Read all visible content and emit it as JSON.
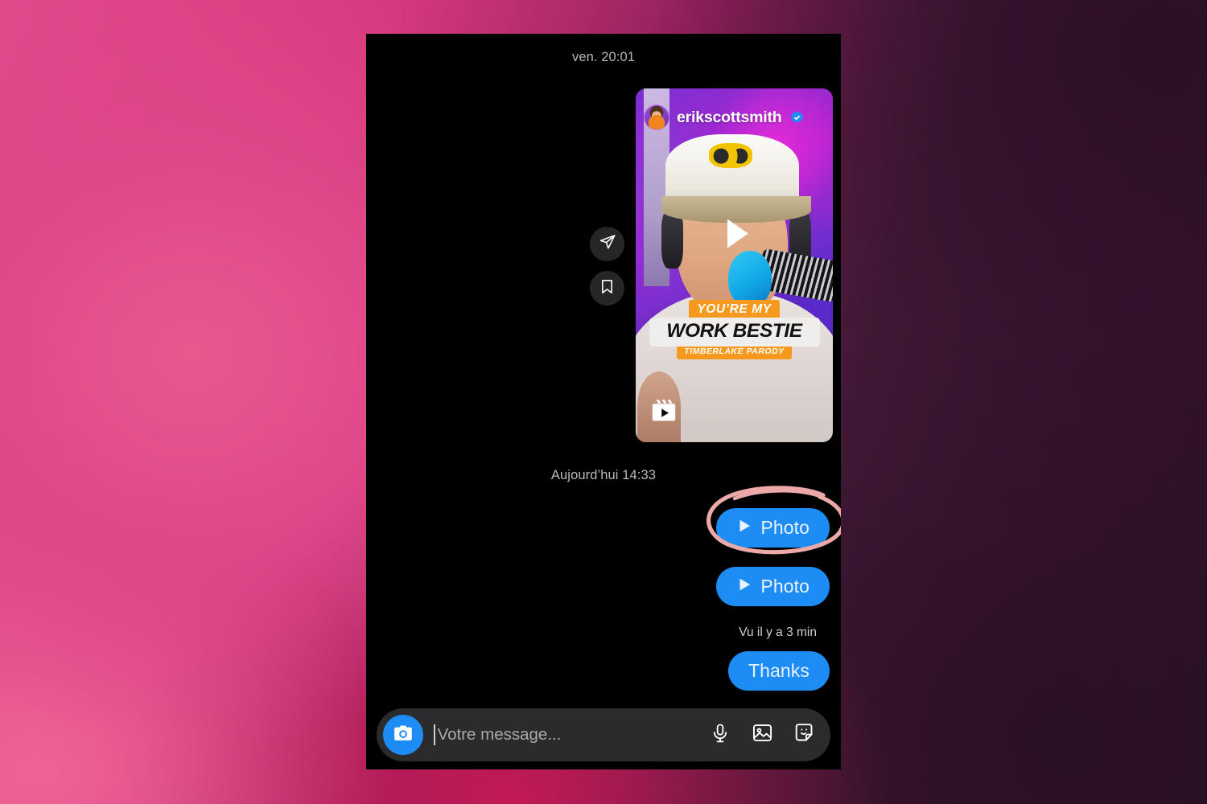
{
  "wallpaper": {
    "colors": {
      "pink": "#e0488a",
      "magenta": "#c21a56",
      "dark_purple": "#2b1128"
    }
  },
  "phone": {
    "screen_background": "#000000"
  },
  "thread": {
    "separator_top": "ven. 20:01",
    "separator_middle": "Aujourd’hui 14:33",
    "seen_status": "Vu il y a 3 min",
    "shared_reel": {
      "username": "erikscottsmith",
      "verified": true,
      "verified_badge_color": "#1d8cf5",
      "caption_line1": "YOU’RE MY",
      "caption_line2": "WORK BESTIE",
      "caption_line3": "TIMBERLAKE PARODY",
      "caption_accent_color": "#f59a1e",
      "actions": [
        {
          "name": "share-icon",
          "label": "Partager"
        },
        {
          "name": "bookmark-icon",
          "label": "Enregistrer"
        }
      ],
      "media_type_badge": "reels-icon",
      "play_overlay": "play-icon"
    },
    "messages": [
      {
        "id": "photo-1",
        "label": "Photo",
        "direction": "outgoing",
        "bubble_color": "#1d8cf5",
        "status": "sending",
        "highlighted": true
      },
      {
        "id": "photo-2",
        "label": "Photo",
        "direction": "outgoing",
        "bubble_color": "#1d8cf5",
        "status": "seen",
        "highlighted": false
      },
      {
        "id": "thanks",
        "label": "Thanks",
        "direction": "outgoing",
        "bubble_color": "#1d8cf5",
        "status": "sent",
        "highlighted": false
      }
    ]
  },
  "composer": {
    "camera_button": "camera-icon",
    "placeholder": "Votre message...",
    "value": "",
    "icons": [
      {
        "name": "microphone-icon",
        "label": "Message vocal"
      },
      {
        "name": "gallery-icon",
        "label": "Galerie"
      },
      {
        "name": "sticker-icon",
        "label": "Autocollant"
      }
    ]
  },
  "annotation": {
    "shape": "ellipse",
    "color": "#eda8a8",
    "target": "photo-1"
  }
}
